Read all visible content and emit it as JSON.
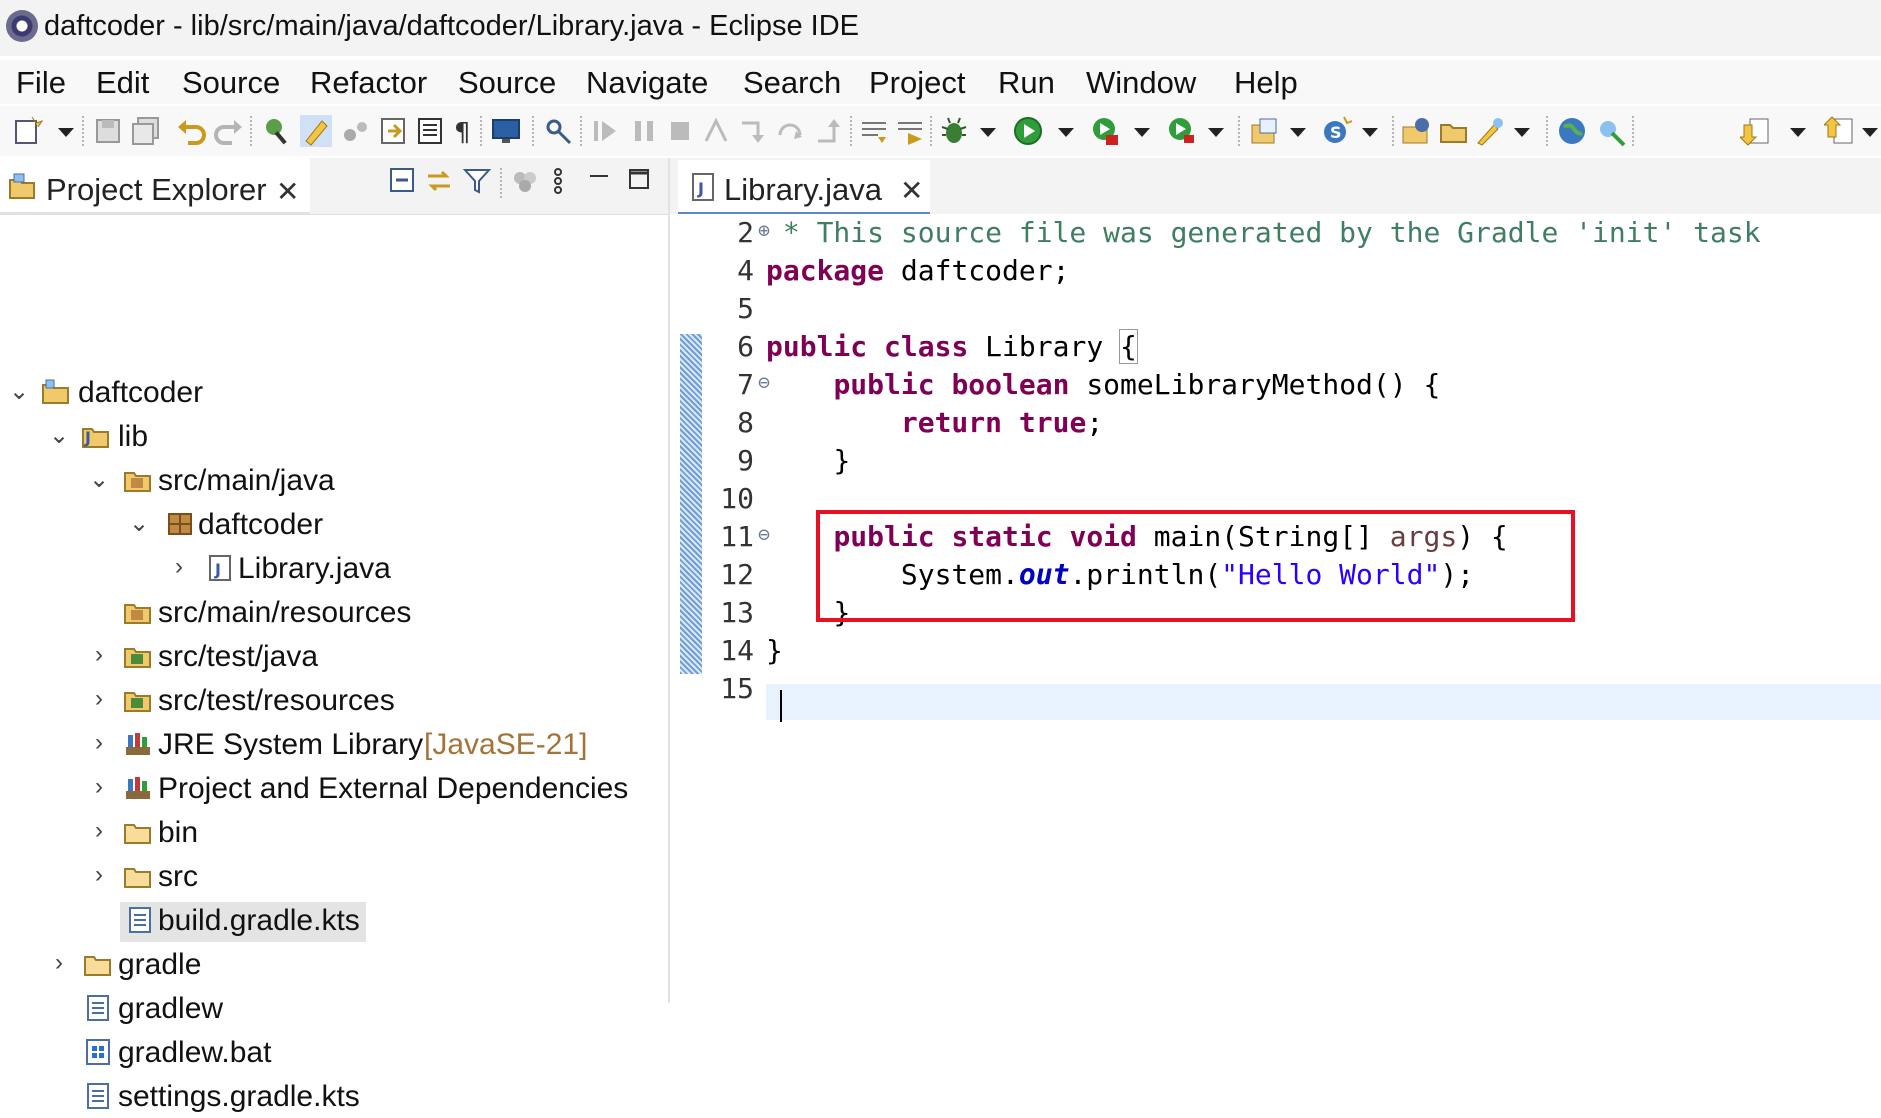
{
  "window": {
    "title": "daftcoder - lib/src/main/java/daftcoder/Library.java - Eclipse IDE"
  },
  "menu": [
    "File",
    "Edit",
    "Source",
    "Refactor",
    "Source",
    "Navigate",
    "Search",
    "Project",
    "Run",
    "Window",
    "Help"
  ],
  "explorer": {
    "tab_label": "Project Explorer",
    "items": [
      {
        "label": "daftcoder",
        "icon": "project-folder-icon"
      },
      {
        "label": "lib",
        "icon": "project-folder-icon"
      },
      {
        "label": "src/main/java",
        "icon": "source-folder-icon"
      },
      {
        "label": "daftcoder",
        "icon": "package-icon"
      },
      {
        "label": "Library.java",
        "icon": "java-file-icon"
      },
      {
        "label": "src/main/resources",
        "icon": "source-folder-icon"
      },
      {
        "label": "src/test/java",
        "icon": "source-folder-icon"
      },
      {
        "label": "src/test/resources",
        "icon": "source-folder-icon"
      },
      {
        "label": "JRE System Library",
        "decoration": "[JavaSE-21]",
        "icon": "library-icon"
      },
      {
        "label": "Project and External Dependencies",
        "icon": "library-icon"
      },
      {
        "label": "bin",
        "icon": "folder-icon"
      },
      {
        "label": "src",
        "icon": "folder-icon"
      },
      {
        "label": "build.gradle.kts",
        "icon": "text-file-icon"
      },
      {
        "label": "gradle",
        "icon": "folder-icon"
      },
      {
        "label": "gradlew",
        "icon": "text-file-icon"
      },
      {
        "label": "gradlew.bat",
        "icon": "batch-file-icon"
      },
      {
        "label": "settings.gradle.kts",
        "icon": "text-file-icon"
      }
    ]
  },
  "editor": {
    "tab_label": "Library.java",
    "line_numbers": [
      "2",
      "4",
      "5",
      "6",
      "7",
      "8",
      "9",
      "10",
      "11",
      "12",
      "13",
      "14",
      "15"
    ],
    "code": {
      "l2": " * This source file was generated by the Gradle 'init' task",
      "l4_kw": "package",
      "l4_rest": " daftcoder;",
      "l6_kw1": "public",
      "l6_kw2": "class",
      "l6_rest": " Library ",
      "l6_brace": "{",
      "l7_kw1": "public",
      "l7_kw2": "boolean",
      "l7_rest": " someLibraryMethod() {",
      "l8_kw1": "return",
      "l8_kw2": "true",
      "l8_rest": ";",
      "l9": "}",
      "l11_kw1": "public",
      "l11_kw2": "static",
      "l11_kw3": "void",
      "l11_mid": " main(String[] ",
      "l11_param": "args",
      "l11_end": ") {",
      "l12_a": "System.",
      "l12_field": "out",
      "l12_b": ".println(",
      "l12_str": "\"Hello World\"",
      "l12_c": ");",
      "l13": "}",
      "l14": "}"
    }
  }
}
